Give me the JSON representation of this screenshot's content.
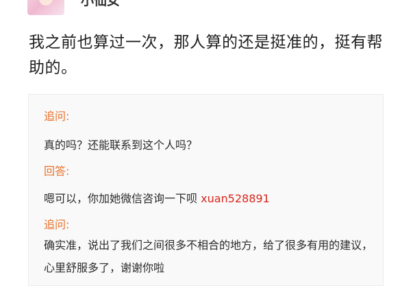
{
  "post": {
    "username": "小仙女",
    "content": "我之前也算过一次，那人算的还是挺准的，挺有帮助的。"
  },
  "qa": [
    {
      "label": "追问:",
      "text": "真的吗？还能联系到这个人吗？"
    },
    {
      "label": "回答:",
      "text": "嗯可以，你加她微信咨询一下呗 ",
      "contact": "xuan528891"
    },
    {
      "label": "追问:",
      "text": "确实准，说出了我们之间很多不相合的地方，给了很多有用的建议，心里舒服多了，谢谢你啦"
    }
  ],
  "colors": {
    "label": "#e8702a",
    "contact": "#d9261c",
    "box_bg": "#f9f9f9"
  }
}
